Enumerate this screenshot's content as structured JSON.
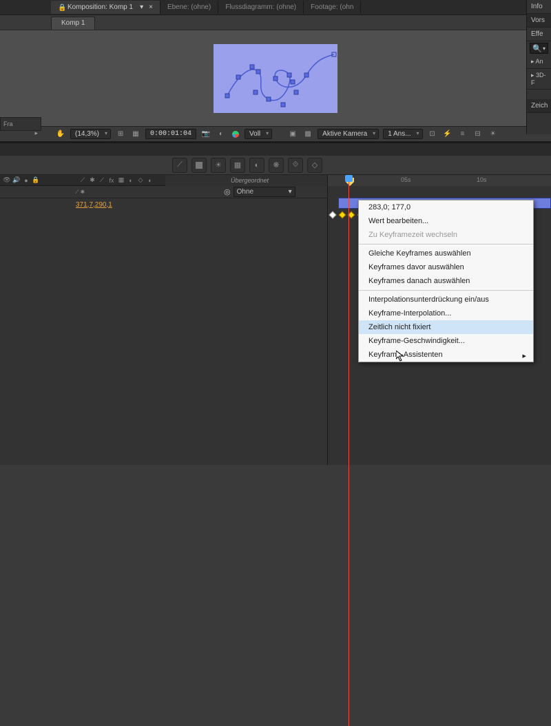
{
  "top_tabs": {
    "composition": "Komposition: Komp 1",
    "layer": "Ebene: (ohne)",
    "flowchart": "Flussdiagramm: (ohne)",
    "footage": "Footage: (ohn"
  },
  "sub_tab": "Komp 1",
  "right_panels": {
    "info": "Info",
    "preview": "Vors",
    "effects": "Effe",
    "animp": "An",
    "threedp": "3D-F",
    "draw": "Zeich"
  },
  "viewer_footer": {
    "zoom": "(14,3%)",
    "timecode": "0:00:01:04",
    "blend": "Voll",
    "camera": "Aktive Kamera",
    "views": "1 Ans..."
  },
  "timeline": {
    "parent_label": "Übergeordnet",
    "parent_value": "Ohne",
    "prop_value": "371,7,290,1",
    "ruler": [
      "05s",
      "10s"
    ]
  },
  "context_menu": {
    "value": "283,0; 177,0",
    "edit": "Wert bearbeiten...",
    "gototime": "Zu Keyframezeit wechseln",
    "sel_same": "Gleiche Keyframes auswählen",
    "sel_before": "Keyframes davor auswählen",
    "sel_after": "Keyframes danach auswählen",
    "interp_toggle": "Interpolationsunterdrückung ein/aus",
    "interp": "Keyframe-Interpolation...",
    "rove": "Zeitlich nicht fixiert",
    "velocity": "Keyframe-Geschwindigkeit...",
    "assist": "Keyframe-Assistenten"
  },
  "left_edge_label": "Fra"
}
